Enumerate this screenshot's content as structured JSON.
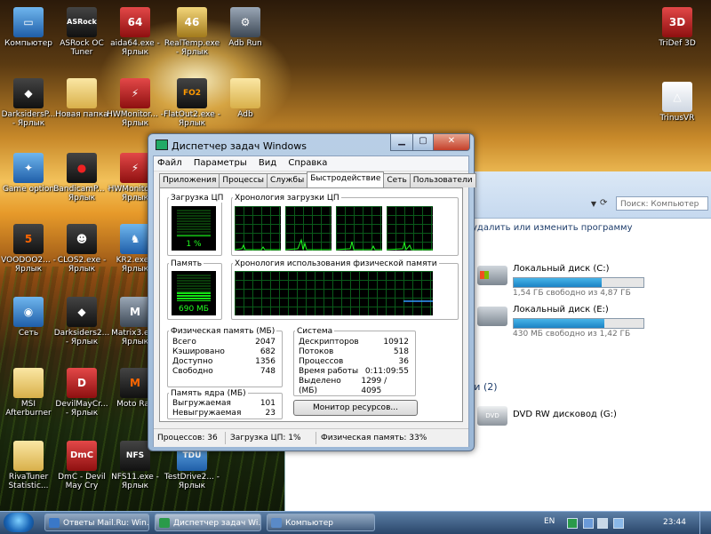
{
  "desktop": {
    "icons": [
      {
        "label": "Компьютер",
        "glyph": "▭"
      },
      {
        "label": "ASRock OC Tuner",
        "glyph": "ASRock"
      },
      {
        "label": "aida64.exe - Ярлык",
        "glyph": "64"
      },
      {
        "label": "RealTemp.exe - Ярлык",
        "glyph": "46"
      },
      {
        "label": "Adb Run",
        "glyph": "⚙"
      },
      {
        "label": "TriDef 3D",
        "glyph": "3D"
      },
      {
        "label": "DarksidersP... - Ярлык",
        "glyph": "◆"
      },
      {
        "label": "Новая папка",
        "glyph": ""
      },
      {
        "label": "HWMonitor... - Ярлык",
        "glyph": "⚡"
      },
      {
        "label": "FlatOut2.exe - Ярлык",
        "glyph": "FO2"
      },
      {
        "label": "Adb",
        "glyph": ""
      },
      {
        "label": "TrinusVR",
        "glyph": "△"
      },
      {
        "label": "Game option",
        "glyph": "✦"
      },
      {
        "label": "BandicamP... - Ярлык",
        "glyph": "●"
      },
      {
        "label": "HWMonito... - Ярлык",
        "glyph": "⚡"
      },
      {
        "label": "VOODOO2... - Ярлык",
        "glyph": "5"
      },
      {
        "label": "CLOS2.exe - Ярлык",
        "glyph": "☻"
      },
      {
        "label": "KR2.exe - Ярлык",
        "glyph": "♞"
      },
      {
        "label": "Сеть",
        "glyph": "◉"
      },
      {
        "label": "Darksiders2... - Ярлык",
        "glyph": "◆"
      },
      {
        "label": "Matrix3.ex - Ярлык",
        "glyph": "M"
      },
      {
        "label": "MSI Afterburner",
        "glyph": ""
      },
      {
        "label": "DevilMayCr... - Ярлык",
        "glyph": "D"
      },
      {
        "label": "Moto Rac",
        "glyph": "M"
      },
      {
        "label": "RivaTuner Statistic...",
        "glyph": ""
      },
      {
        "label": "DmC - Devil May Cry",
        "glyph": "DmC"
      },
      {
        "label": "NFS11.exe - Ярлык",
        "glyph": "NFS"
      },
      {
        "label": "TestDrive2... - Ярлык",
        "glyph": "TDU"
      }
    ]
  },
  "explorer": {
    "search_placeholder": "Поиск: Компьютер",
    "command": "удалить или изменить программу",
    "drives": [
      {
        "name": "Локальный диск (C:)",
        "free": "1,54 ГБ свободно из 4,87 ГБ",
        "used_fraction": 0.68
      },
      {
        "name": "Локальный диск (E:)",
        "free": "430 МБ свободно из 1,42 ГБ",
        "used_fraction": 0.7
      }
    ],
    "section_label": "ми (2)",
    "dvd": {
      "name": "DVD RW дисковод (G:)",
      "badge": "DVD"
    }
  },
  "taskmgr": {
    "title": "Диспетчер задач Windows",
    "menu": [
      "Файл",
      "Параметры",
      "Вид",
      "Справка"
    ],
    "tabs": [
      "Приложения",
      "Процессы",
      "Службы",
      "Быстродействие",
      "Сеть",
      "Пользователи"
    ],
    "active_tab": "Быстродействие",
    "cpu_label": "Загрузка ЦП",
    "cpu_value": "1 %",
    "cpu_fraction": 0.01,
    "cpu_history_label": "Хронология загрузки ЦП",
    "mem_label": "Память",
    "mem_value": "690 МБ",
    "mem_fraction": 0.33,
    "mem_history_label": "Хронология использования физической памяти",
    "physical": {
      "title": "Физическая память (МБ)",
      "rows": [
        {
          "k": "Всего",
          "v": "2047"
        },
        {
          "k": "Кэшировано",
          "v": "682"
        },
        {
          "k": "Доступно",
          "v": "1356"
        },
        {
          "k": "Свободно",
          "v": "748"
        }
      ]
    },
    "kernel": {
      "title": "Память ядра (МБ)",
      "rows": [
        {
          "k": "Выгружаемая",
          "v": "101"
        },
        {
          "k": "Невыгружаемая",
          "v": "23"
        }
      ]
    },
    "system": {
      "title": "Система",
      "rows": [
        {
          "k": "Дескрипторов",
          "v": "10912"
        },
        {
          "k": "Потоков",
          "v": "518"
        },
        {
          "k": "Процессов",
          "v": "36"
        },
        {
          "k": "Время работы",
          "v": "0:11:09:55"
        },
        {
          "k": "Выделено (МБ)",
          "v": "1299 / 4095"
        }
      ]
    },
    "resource_button": "Монитор ресурсов...",
    "status": {
      "processes": "Процессов: 36",
      "cpu": "Загрузка ЦП: 1%",
      "memory": "Физическая память: 33%"
    }
  },
  "taskbar": {
    "buttons": [
      {
        "label": "Ответы Mail.Ru: Win...",
        "color": "#3a78c8"
      },
      {
        "label": "Диспетчер задач Wi...",
        "color": "#2a9a4a"
      },
      {
        "label": "Компьютер",
        "color": "#5a8ac8"
      }
    ],
    "lang": "EN",
    "clock": "23:44"
  }
}
